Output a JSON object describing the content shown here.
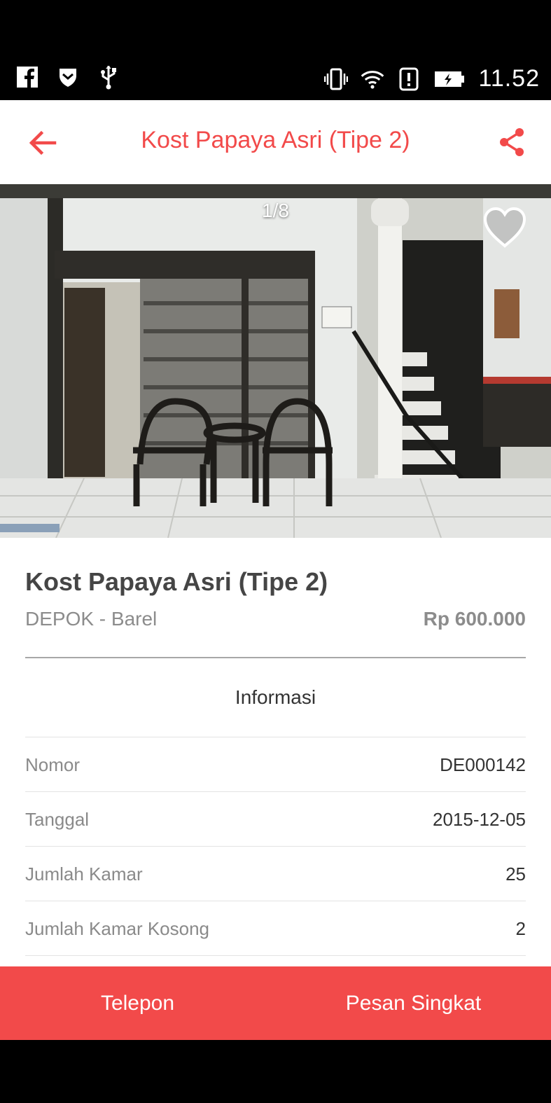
{
  "status_bar": {
    "time": "11.52",
    "left_icons": [
      "facebook-icon",
      "shield-icon",
      "usb-icon"
    ],
    "right_icons": [
      "vibrate-icon",
      "wifi-icon",
      "alert-icon",
      "battery-charging-icon"
    ]
  },
  "app_bar": {
    "title": "Kost Papaya Asri (Tipe 2)",
    "accent_color": "#f24a4a"
  },
  "gallery": {
    "counter": "1/8"
  },
  "listing": {
    "name": "Kost Papaya Asri (Tipe 2)",
    "location": "DEPOK - Barel",
    "price": "Rp 600.000"
  },
  "info": {
    "title": "Informasi",
    "rows": [
      {
        "label": "Nomor",
        "value": "DE000142"
      },
      {
        "label": "Tanggal",
        "value": "2015-12-05"
      },
      {
        "label": "Jumlah Kamar",
        "value": "25"
      },
      {
        "label": "Jumlah Kamar Kosong",
        "value": "2"
      }
    ]
  },
  "actions": {
    "call_label": "Telepon",
    "sms_label": "Pesan Singkat"
  }
}
